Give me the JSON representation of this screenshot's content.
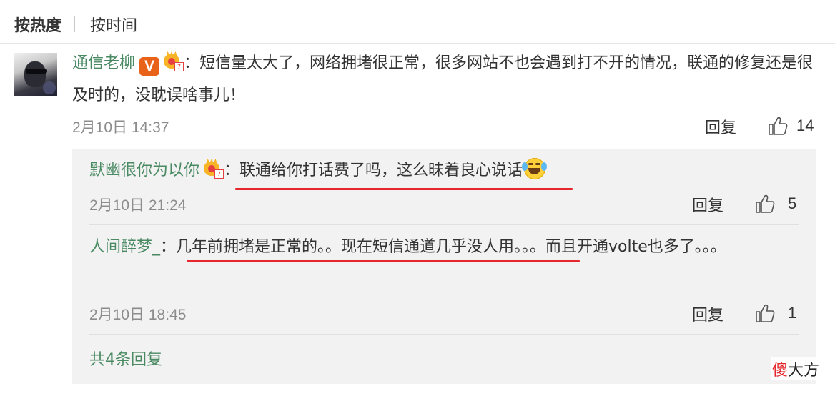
{
  "sort": {
    "active": "按热度",
    "inactive": "按时间"
  },
  "comment": {
    "username": "通信老柳",
    "vip_badge": "V",
    "separator": "：",
    "text": "短信量太大了，网络拥堵很正常，很多网站不也会遇到打不开的情况，联通的修复还是很及时的，没耽误啥事儿！",
    "time": "2月10日 14:37",
    "reply_label": "回复",
    "likes": "14"
  },
  "replies": [
    {
      "username": "默幽很你为以你",
      "separator": "：",
      "text": "联通给你打话费了吗，这么昧着良心说话",
      "time": "2月10日 21:24",
      "reply_label": "回复",
      "likes": "5"
    },
    {
      "username": "人间醉梦_",
      "separator": "：",
      "text": "几年前拥堵是正常的。。现在短信通道几乎没人用。。。而且开通volte也多了。。。",
      "time": "2月10日 18:45",
      "reply_label": "回复",
      "likes": "1"
    }
  ],
  "more_replies": "共4条回复",
  "watermark": {
    "first": "傻",
    "rest": "大方"
  },
  "colors": {
    "username_green": "#4a8a63",
    "highlight_red": "#e4282d",
    "reply_bg": "#f2f2f2",
    "vip_orange": "#e8621a"
  },
  "icons": [
    "vip-icon",
    "crown-icon",
    "like-icon",
    "laugh-cry-emoji-icon"
  ]
}
